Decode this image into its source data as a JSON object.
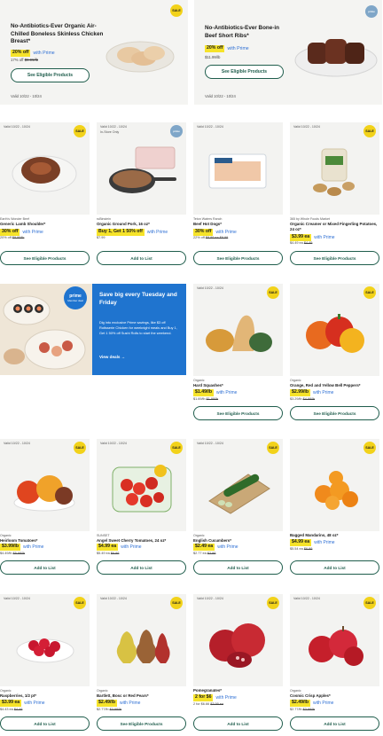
{
  "colors": {
    "accent_green": "#1f5d4c",
    "sale_yellow": "#f2d21a",
    "prime_blue": "#2f70d4",
    "promo_blue": "#1f74cf"
  },
  "heroes": [
    {
      "title": "No-Antibiotics-Ever Organic Air-Chilled Boneless Skinless Chicken Breast*",
      "tag": "20% off",
      "prime": "with Prime",
      "reg_a": "17% off",
      "reg_b": "$9.99/lb",
      "button": "See Eligible Products",
      "valid": "Valid 10/22 - 10/24",
      "badge": "SALE"
    },
    {
      "title": "No-Antibiotics-Ever Bone-in Beef Short Ribs*",
      "tag": "20% off",
      "prime": "with Prime",
      "reg_a": "$11.99/lb",
      "reg_b": "",
      "button": "See Eligible Products",
      "valid": "Valid 10/22 - 10/24",
      "badge": "prime"
    }
  ],
  "products": [
    {
      "valid": "Valid 10/22 - 10/24",
      "sub": "",
      "badge": "SALE",
      "brand": "Earth's Wonder Beef",
      "name": "Generic Lamb Shoulder*",
      "tag": "30% off",
      "prime": "with Prime",
      "reg_a": "20% off",
      "reg_b": "$9.99/lb",
      "button": "See Eligible Products"
    },
    {
      "valid": "Valid 10/22 - 10/24",
      "sub": "In-Store Only",
      "badge": "prime",
      "brand": "ruBinstein",
      "name": "Organic Ground Pork, 16 oz*",
      "tag": "Buy 1, Get 1 50% off",
      "prime": "with Prime",
      "reg_a": "$7.99",
      "reg_b": "",
      "button": "Add to List"
    },
    {
      "valid": "Valid 10/22 - 10/24",
      "sub": "",
      "badge": "",
      "brand": "Teton Waters Ranch",
      "name": "Beef Hot Dogs*",
      "tag": "30% off",
      "prime": "with Prime",
      "reg_a": "22% off",
      "reg_b": "$8.99 ea $9.99",
      "button": "See Eligible Products"
    },
    {
      "valid": "Valid 10/22 - 10/24",
      "sub": "",
      "badge": "SALE",
      "brand": "365 by Whole Foods Market",
      "name": "Organic Creamer or Mixed Fingerling Potatoes, 24 oz*",
      "tag": "$3.99 ea",
      "prime": "with Prime",
      "reg_a": "$4.49 ea",
      "reg_b": "$4.49",
      "button": "See Eligible Products"
    },
    {
      "valid": "Valid 10/22 - 10/24",
      "sub": "",
      "badge": "SALE",
      "brand": "Organic",
      "name": "Hard Squashes*",
      "tag": "$1.49/lb",
      "prime": "with Prime",
      "reg_a": "$1.69/lb",
      "reg_b": "$1.99/lb",
      "button": "See Eligible Products"
    },
    {
      "valid": "",
      "sub": "",
      "badge": "SALE",
      "brand": "Organic",
      "name": "Orange, Red and Yellow Bell Peppers*",
      "tag": "$2.99/lb",
      "prime": "with Prime",
      "reg_a": "$3.29/lb",
      "reg_b": "$4.99/lb",
      "button": "See Eligible Products"
    },
    {
      "valid": "Valid 10/22 - 10/24",
      "sub": "",
      "badge": "SALE",
      "brand": "Organic",
      "name": "Heirloom Tomatoes*",
      "tag": "$3.99/lb",
      "prime": "with Prime",
      "reg_a": "$4.49/lb",
      "reg_b": "$5.99/lb",
      "button": "Add to List"
    },
    {
      "valid": "Valid 10/22 - 10/24",
      "sub": "",
      "badge": "SALE",
      "brand": "SUNSET",
      "name": "Angel Sweet Cherry Tomatoes, 24 oz*",
      "tag": "$4.99 ea",
      "prime": "with Prime",
      "reg_a": "$5.49 ea",
      "reg_b": "$6.99",
      "button": "Add to List"
    },
    {
      "valid": "Valid 10/22 - 10/24",
      "sub": "",
      "badge": "SALE",
      "brand": "Organic",
      "name": "English Cucumbers*",
      "tag": "$2.49 ea",
      "prime": "with Prime",
      "reg_a": "$2.77 ea",
      "reg_b": "$2.99",
      "button": "Add to List"
    },
    {
      "valid": "",
      "sub": "",
      "badge": "SALE",
      "brand": "",
      "name": "Bagged Mandarins, 48 oz*",
      "tag": "$4.99 ea",
      "prime": "with Prime",
      "reg_a": "$5.54 ea",
      "reg_b": "$6.99",
      "button": "Add to List"
    },
    {
      "valid": "Valid 10/22 - 10/24",
      "sub": "",
      "badge": "SALE",
      "brand": "Organic",
      "name": "Raspberries, 1/2 pt*",
      "tag": "$3.99 ea",
      "prime": "with Prime",
      "reg_a": "$4.43 ea",
      "reg_b": "$4.49",
      "button": "Add to List"
    },
    {
      "valid": "Valid 10/22 - 10/24",
      "sub": "",
      "badge": "SALE",
      "brand": "Organic",
      "name": "Bartlett, Bosc or Red Pears*",
      "tag": "$2.49/lb",
      "prime": "with Prime",
      "reg_a": "$2.77/lb",
      "reg_b": "$3.99/lb",
      "button": "See Eligible Products"
    },
    {
      "valid": "Valid 10/22 - 10/24",
      "sub": "",
      "badge": "SALE",
      "brand": "",
      "name": "Pomegranates*",
      "tag": "2 for $6",
      "prime": "with Prime",
      "reg_a": "2 for $6.66",
      "reg_b": "$3.99 ea",
      "button": "Add to List"
    },
    {
      "valid": "Valid 10/22 - 10/24",
      "sub": "",
      "badge": "SALE",
      "brand": "Organic",
      "name": "Cosmic Crisp Apples*",
      "tag": "$2.49/lb",
      "prime": "with Prime",
      "reg_a": "$2.77/lb",
      "reg_b": "$3.99/lb",
      "button": "Add to List"
    }
  ],
  "promo": {
    "badge_top": "prime",
    "badge_bottom": "Member deal",
    "title": "Save big every Tuesday and Friday",
    "body": "Dig into exclusive Prime savings, like $3 off Rotisserie Chicken for weeknight meals and Buy 1, Get 1 50% off Sushi Rolls to start the weekend.",
    "link": "View deals →"
  }
}
